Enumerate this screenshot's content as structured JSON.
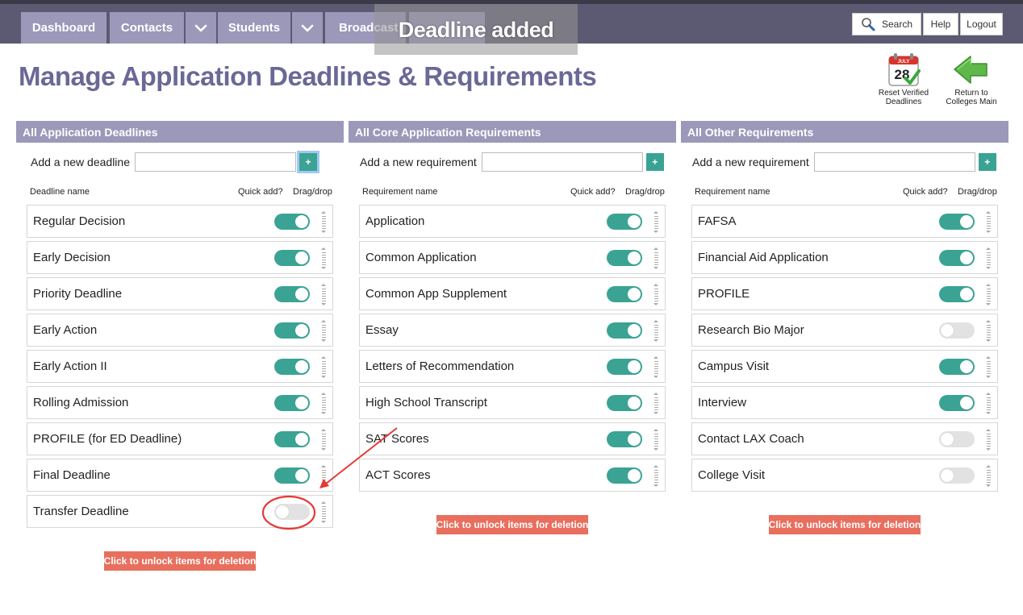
{
  "nav": {
    "dashboard": "Dashboard",
    "contacts": "Contacts",
    "students": "Students",
    "broadcast": "Broadcast",
    "toast": "Deadline added",
    "search": "Search",
    "help": "Help",
    "logout": "Logout"
  },
  "page": {
    "title": "Manage Application Deadlines & Requirements"
  },
  "actions": {
    "reset_verified": "Reset Verified Deadlines",
    "calendar_month": "JULY",
    "calendar_day": "28",
    "return_main": "Return to Colleges Main"
  },
  "panels": [
    {
      "header": "All Application Deadlines",
      "add_label": "Add a new deadline",
      "add_button": "+",
      "col_name": "Deadline name",
      "col_quick": "Quick add?",
      "col_drag": "Drag/drop",
      "items": [
        {
          "label": "Regular Decision",
          "quick_add": true
        },
        {
          "label": "Early Decision",
          "quick_add": true
        },
        {
          "label": "Priority Deadline",
          "quick_add": true
        },
        {
          "label": "Early Action",
          "quick_add": true
        },
        {
          "label": "Early Action II",
          "quick_add": true
        },
        {
          "label": "Rolling Admission",
          "quick_add": true
        },
        {
          "label": "PROFILE (for ED Deadline)",
          "quick_add": true
        },
        {
          "label": "Final Deadline",
          "quick_add": true
        },
        {
          "label": "Transfer Deadline",
          "quick_add": false
        }
      ],
      "unlock": "Click to unlock items for deletion"
    },
    {
      "header": "All Core Application Requirements",
      "add_label": "Add a new requirement",
      "add_button": "+",
      "col_name": "Requirement name",
      "col_quick": "Quick add?",
      "col_drag": "Drag/drop",
      "items": [
        {
          "label": "Application",
          "quick_add": true
        },
        {
          "label": "Common Application",
          "quick_add": true
        },
        {
          "label": "Common App Supplement",
          "quick_add": true
        },
        {
          "label": "Essay",
          "quick_add": true
        },
        {
          "label": "Letters of Recommendation",
          "quick_add": true
        },
        {
          "label": "High School Transcript",
          "quick_add": true
        },
        {
          "label": "SAT Scores",
          "quick_add": true
        },
        {
          "label": "ACT Scores",
          "quick_add": true
        }
      ],
      "unlock": "Click to unlock items for deletion"
    },
    {
      "header": "All Other Requirements",
      "add_label": "Add a new requirement",
      "add_button": "+",
      "col_name": "Requirement name",
      "col_quick": "Quick add?",
      "col_drag": "Drag/drop",
      "items": [
        {
          "label": "FAFSA",
          "quick_add": true
        },
        {
          "label": "Financial Aid Application",
          "quick_add": true
        },
        {
          "label": "PROFILE",
          "quick_add": true
        },
        {
          "label": "Research Bio Major",
          "quick_add": false
        },
        {
          "label": "Campus Visit",
          "quick_add": true
        },
        {
          "label": "Interview",
          "quick_add": true
        },
        {
          "label": "Contact LAX Coach",
          "quick_add": false
        },
        {
          "label": "College Visit",
          "quick_add": false
        }
      ],
      "unlock": "Click to unlock items for deletion"
    }
  ],
  "colors": {
    "nav_bar": "#5c5a72",
    "nav_tab": "#9b98ba",
    "title": "#6a6896",
    "toggle_on": "#3aa394",
    "toggle_off": "#e2e2e2",
    "unlock_button": "#e86f5e",
    "annotation": "#e53935"
  },
  "icons": {
    "caret": "chevron-down-icon",
    "search": "magnifier-icon",
    "reset": "calendar-check-icon",
    "return": "arrow-left-icon",
    "drag": "drag-handle-icon"
  }
}
